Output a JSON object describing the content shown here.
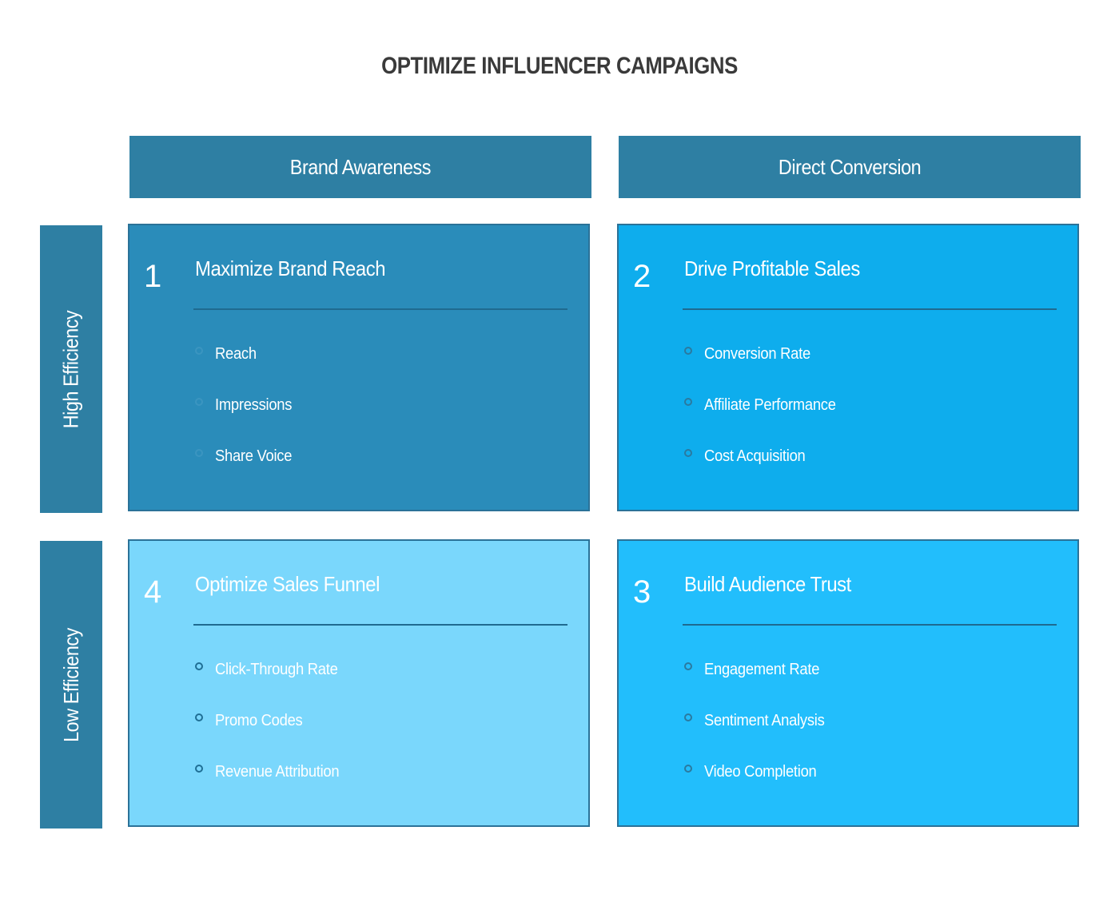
{
  "title": "OPTIMIZE INFLUENCER CAMPAIGNS",
  "columns": [
    "Brand Awareness",
    "Direct Conversion"
  ],
  "rows": [
    "High Efficiency",
    "Low Efficiency"
  ],
  "quadrants": {
    "q1": {
      "number": "1",
      "title": "Maximize Brand Reach",
      "items": [
        "Reach",
        "Impressions",
        "Share Voice"
      ],
      "color": "#2a8cba"
    },
    "q2": {
      "number": "2",
      "title": "Drive Profitable Sales",
      "items": [
        "Conversion Rate",
        "Affiliate Performance",
        "Cost Acquisition"
      ],
      "color": "#0eaded"
    },
    "q4": {
      "number": "4",
      "title": "Optimize Sales Funnel",
      "items": [
        "Click-Through Rate",
        "Promo Codes",
        "Revenue Attribution"
      ],
      "color": "#7ad7fc"
    },
    "q3": {
      "number": "3",
      "title": "Build Audience Trust",
      "items": [
        "Engagement Rate",
        "Sentiment Analysis",
        "Video Completion"
      ],
      "color": "#22befc"
    }
  },
  "colors": {
    "header": "#2e7fa3",
    "title_text": "#3a3a3a"
  }
}
